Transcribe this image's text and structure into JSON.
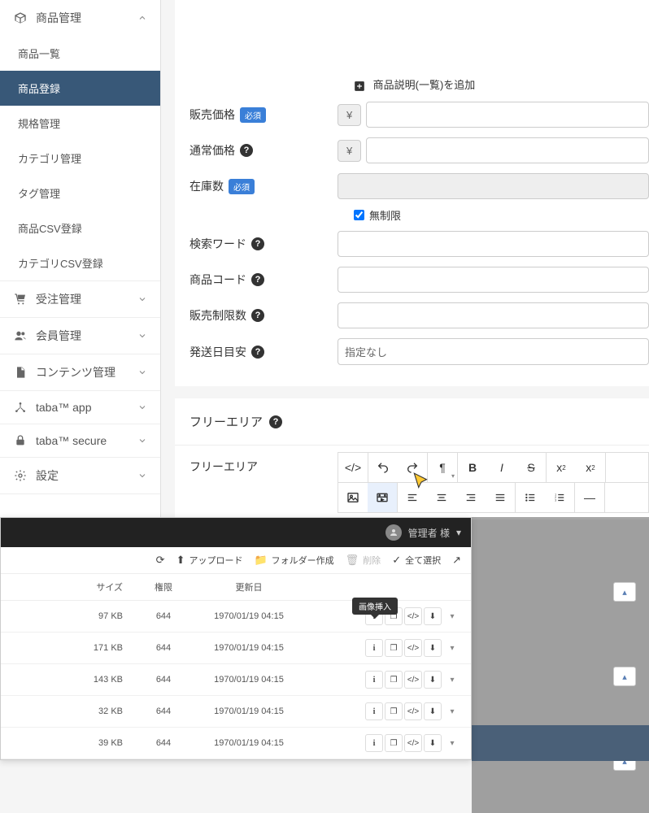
{
  "sidebar": {
    "sections": [
      {
        "label": "商品管理",
        "icon": "cube",
        "expanded": true,
        "items": [
          "商品一覧",
          "商品登録",
          "規格管理",
          "カテゴリ管理",
          "タグ管理",
          "商品CSV登録",
          "カテゴリCSV登録"
        ],
        "active_index": 1
      },
      {
        "label": "受注管理",
        "icon": "cart",
        "expanded": false
      },
      {
        "label": "会員管理",
        "icon": "users",
        "expanded": false
      },
      {
        "label": "コンテンツ管理",
        "icon": "file",
        "expanded": false
      },
      {
        "label": "taba™ app",
        "icon": "share",
        "expanded": false
      },
      {
        "label": "taba™ secure",
        "icon": "lock",
        "expanded": false
      },
      {
        "label": "設定",
        "icon": "gear",
        "expanded": false
      }
    ]
  },
  "form": {
    "add_description": "商品説明(一覧)を追加",
    "rows": {
      "sale_price": {
        "label": "販売価格",
        "required": true,
        "prefix": "¥"
      },
      "normal_price": {
        "label": "通常価格",
        "help": true,
        "prefix": "¥"
      },
      "stock": {
        "label": "在庫数",
        "required": true
      },
      "unlimited": {
        "label": "無制限",
        "checked": true
      },
      "search_word": {
        "label": "検索ワード",
        "help": true
      },
      "product_code": {
        "label": "商品コード",
        "help": true
      },
      "sale_limit": {
        "label": "販売制限数",
        "help": true
      },
      "ship_estimate": {
        "label": "発送日目安",
        "help": true,
        "placeholder": "指定なし"
      }
    }
  },
  "free_area": {
    "section_title": "フリーエリア",
    "label": "フリーエリア",
    "toolbar_icons": {
      "row1": [
        "code-view",
        "undo",
        "redo",
        "paragraph",
        "bold",
        "italic",
        "strike",
        "superscript",
        "subscript"
      ],
      "row2": [
        "image",
        "video",
        "align-left",
        "align-center",
        "align-right",
        "align-justify",
        "list-ul",
        "list-ol",
        "hr"
      ]
    }
  },
  "file_manager": {
    "user_label": "管理者 様",
    "toolbar": {
      "refresh": "",
      "upload": "アップロード",
      "new_folder": "フォルダー作成",
      "delete": "削除",
      "select_all": "全て選択",
      "external": ""
    },
    "headers": {
      "size": "サイズ",
      "perm": "権限",
      "date": "更新日"
    },
    "tooltip": "画像挿入",
    "rows": [
      {
        "size": "97 KB",
        "perm": "644",
        "date": "1970/01/19 04:15"
      },
      {
        "size": "171 KB",
        "perm": "644",
        "date": "1970/01/19 04:15"
      },
      {
        "size": "143 KB",
        "perm": "644",
        "date": "1970/01/19 04:15"
      },
      {
        "size": "32 KB",
        "perm": "644",
        "date": "1970/01/19 04:15"
      },
      {
        "size": "39 KB",
        "perm": "644",
        "date": "1970/01/19 04:15"
      }
    ]
  }
}
